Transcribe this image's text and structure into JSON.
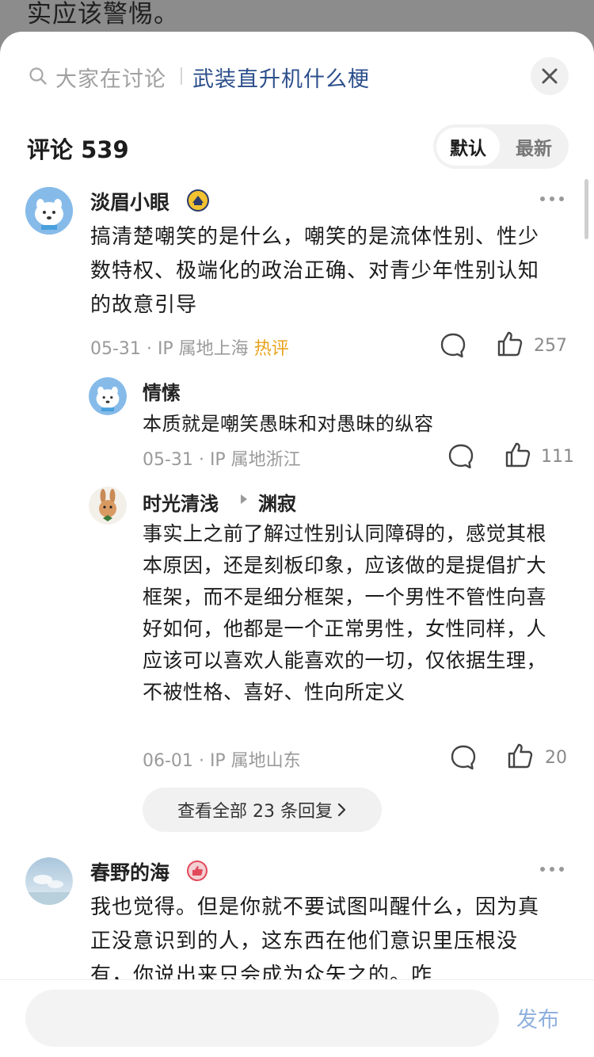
{
  "backdrop": {
    "text": "实应该警惕。"
  },
  "search": {
    "prefix": "大家在讨论",
    "topic": "武装直升机什么梗"
  },
  "comments_header": {
    "title": "评论 539",
    "sort_default": "默认",
    "sort_newest": "最新"
  },
  "comments": [
    {
      "author": "淡眉小眼",
      "text": "搞清楚嘲笑的是什么，嘲笑的是流体性别、性少数特权、极端化的政治正确、对青少年性别认知的故意引导",
      "date": "05-31",
      "location": "IP 属地上海",
      "badge": "热评",
      "likes": "257"
    },
    {
      "author": "春野的海",
      "text": "我也觉得。但是你就不要试图叫醒什么，因为真正没意识到的人，这东西在他们意识里压根没有，你说出来只会成为众矢之的。咋"
    }
  ],
  "replies": [
    {
      "author": "情愫",
      "text": "本质就是嘲笑愚昧和对愚昧的纵容",
      "date": "05-31",
      "location": "IP 属地浙江",
      "likes": "111"
    },
    {
      "author": "时光清浅",
      "reply_to": "渊寂",
      "text": "事实上之前了解过性别认同障碍的，感觉其根本原因，还是刻板印象，应该做的是提倡扩大框架，而不是细分框架，一个男性不管性向喜好如何，他都是一个正常男性，女性同样，人应该可以喜欢人能喜欢的一切，仅依据生理，不被性格、喜好、性向所定义",
      "date": "06-01",
      "location": "IP 属地山东",
      "likes": "20"
    }
  ],
  "view_all": {
    "label": "查看全部 23 条回复"
  },
  "bottom_bar": {
    "input_placeholder": "",
    "publish_label": "发布"
  },
  "separator": "·",
  "colors": {
    "accent": "#2c4f8c",
    "hot": "#e8a21b",
    "publish": "#8fb0dd"
  }
}
